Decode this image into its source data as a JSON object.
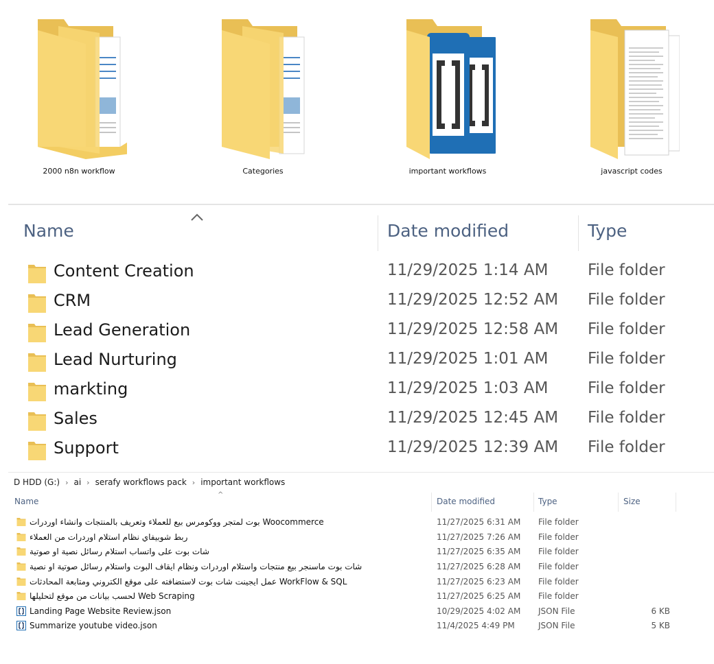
{
  "large_icons": [
    {
      "label": "2000 n8n workflow",
      "icon": "folder-with-documents-icon"
    },
    {
      "label": "Categories",
      "icon": "folder-with-documents-icon"
    },
    {
      "label": "important workflows",
      "icon": "folder-with-brackets-files-icon"
    },
    {
      "label": "javascript codes",
      "icon": "folder-with-text-files-icon"
    }
  ],
  "big_view": {
    "columns": {
      "name": "Name",
      "date": "Date modified",
      "type": "Type"
    },
    "rows": [
      {
        "name": "Content Creation",
        "date": "11/29/2025 1:14 AM",
        "type": "File folder"
      },
      {
        "name": "CRM",
        "date": "11/29/2025 12:52 AM",
        "type": "File folder"
      },
      {
        "name": "Lead Generation",
        "date": "11/29/2025 12:58 AM",
        "type": "File folder"
      },
      {
        "name": "Lead Nurturing",
        "date": "11/29/2025 1:01 AM",
        "type": "File folder"
      },
      {
        "name": "markting",
        "date": "11/29/2025 1:03 AM",
        "type": "File folder"
      },
      {
        "name": "Sales",
        "date": "11/29/2025 12:45 AM",
        "type": "File folder"
      },
      {
        "name": "Support",
        "date": "11/29/2025 12:39 AM",
        "type": "File folder"
      }
    ]
  },
  "small_view": {
    "breadcrumb": [
      "D HDD (G:)",
      "ai",
      "serafy workflows pack",
      "important workflows"
    ],
    "columns": {
      "name": "Name",
      "date": "Date modified",
      "type": "Type",
      "size": "Size"
    },
    "rows": [
      {
        "kind": "folder",
        "name": "بوت لمتجر ووكومرس بيع للعملاء وتعريف بالمنتجات وانشاء اوردرات Woocommerce",
        "date": "11/27/2025 6:31 AM",
        "type": "File folder",
        "size": ""
      },
      {
        "kind": "folder",
        "name": "ربط شوبيفاي نظام استلام اوردرات من العملاء",
        "date": "11/27/2025 7:26 AM",
        "type": "File folder",
        "size": ""
      },
      {
        "kind": "folder",
        "name": "شات بوت على واتساب استلام رسائل نصية او صوتية",
        "date": "11/27/2025 6:35 AM",
        "type": "File folder",
        "size": ""
      },
      {
        "kind": "folder",
        "name": "شات بوت ماسنجر بيع منتجات واستلام اوردرات ونظام ايقاف البوت واستلام رسائل صوتية او نصية",
        "date": "11/27/2025 6:28 AM",
        "type": "File folder",
        "size": ""
      },
      {
        "kind": "folder",
        "name": "عمل ايجينت شات بوت لاستضافته على موقع الكتروني ومتابعة المحادثات WorkFlow & SQL",
        "date": "11/27/2025 6:23 AM",
        "type": "File folder",
        "size": ""
      },
      {
        "kind": "folder",
        "name": "لحسب بيانات من موقع لتحليلها Web Scraping",
        "date": "11/27/2025 6:25 AM",
        "type": "File folder",
        "size": ""
      },
      {
        "kind": "json",
        "name": "Landing Page Website Review.json",
        "date": "10/29/2025 4:02 AM",
        "type": "JSON File",
        "size": "6 KB"
      },
      {
        "kind": "json",
        "name": "Summarize youtube video.json",
        "date": "11/4/2025 4:49 PM",
        "type": "JSON File",
        "size": "5 KB"
      }
    ]
  },
  "colors": {
    "folder": "#f8d775",
    "folder_dark": "#e8b84a",
    "header_text": "#4d6282",
    "json_blue": "#1f6fb5"
  }
}
